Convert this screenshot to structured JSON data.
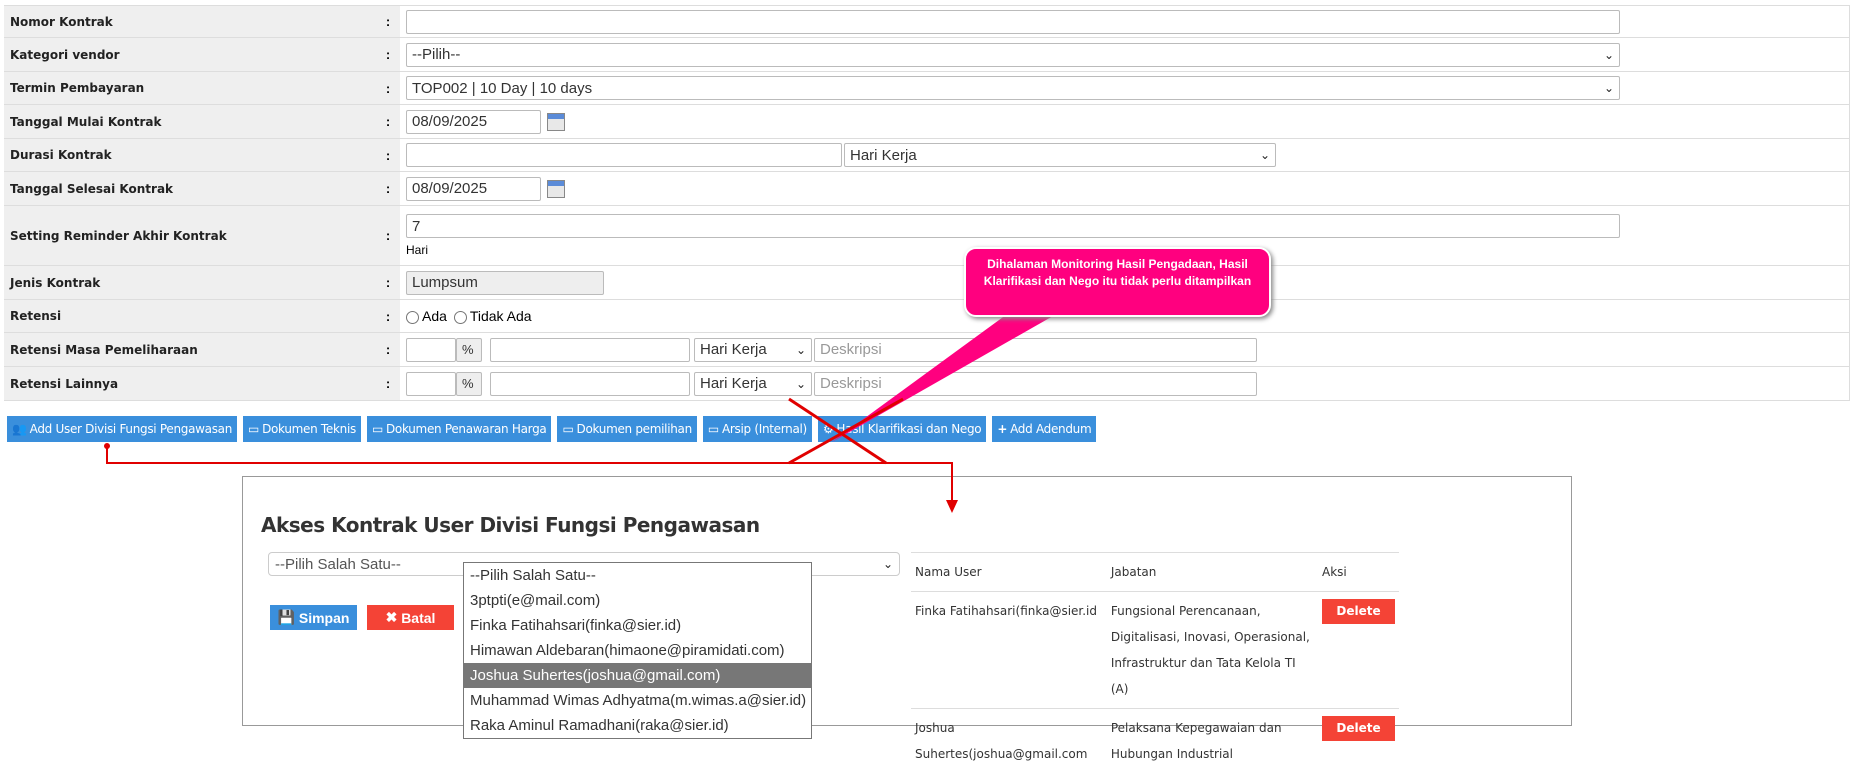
{
  "form": {
    "nomor_kontrak": {
      "label": "Nomor Kontrak",
      "value": ""
    },
    "kategori_vendor": {
      "label": "Kategori vendor",
      "value": "--Pilih--"
    },
    "termin": {
      "label": "Termin Pembayaran",
      "value": "TOP002 | 10 Day | 10 days"
    },
    "tgl_mulai": {
      "label": "Tanggal Mulai Kontrak",
      "value": "08/09/2025"
    },
    "durasi": {
      "label": "Durasi Kontrak",
      "value": "",
      "unit": "Hari Kerja"
    },
    "tgl_selesai": {
      "label": "Tanggal Selesai Kontrak",
      "value": "08/09/2025"
    },
    "reminder": {
      "label": "Setting Reminder Akhir Kontrak",
      "value": "7",
      "unit": "Hari"
    },
    "jenis": {
      "label": "Jenis Kontrak",
      "value": "Lumpsum"
    },
    "retensi": {
      "label": "Retensi",
      "opt1": "Ada",
      "opt2": "Tidak Ada"
    },
    "retensi_masa": {
      "label": "Retensi Masa Pemeliharaan",
      "pct": "%",
      "unit": "Hari Kerja",
      "desc_placeholder": "Deskripsi"
    },
    "retensi_lain": {
      "label": "Retensi Lainnya",
      "pct": "%",
      "unit": "Hari Kerja",
      "desc_placeholder": "Deskripsi"
    },
    "colon": ":"
  },
  "buttons": [
    "Add User Divisi Fungsi Pengawasan",
    "Dokumen Teknis",
    "Dokumen Penawaran Harga",
    "Dokumen pemilihan",
    "Arsip (Internal)",
    "Hasil Klarifikasi dan Nego",
    "Add Adendum"
  ],
  "callout": "Dihalaman Monitoring Hasil Pengadaan, Hasil Klarifikasi dan Nego itu tidak perlu ditampilkan",
  "modal": {
    "title": "Akses Kontrak User Divisi Fungsi Pengawasan",
    "select": "--Pilih Salah Satu--",
    "simpan": "Simpan",
    "batal": "Batal",
    "headers": [
      "Nama User",
      "Jabatan",
      "Aksi"
    ],
    "rows": [
      {
        "nama": "Finka Fatihahsari(finka@sier.id",
        "jabatan": "Fungsional Perencanaan, Digitalisasi, Inovasi, Operasional, Infrastruktur dan Tata Kelola TI (A)",
        "aksi": "Delete"
      },
      {
        "nama": "Joshua Suhertes(joshua@gmail.com",
        "jabatan": "Pelaksana Kepegawaian dan Hubungan Industrial",
        "aksi": "Delete"
      }
    ],
    "options": [
      "--Pilih Salah Satu--",
      "3ptpti(e@mail.com)",
      "Finka Fatihahsari(finka@sier.id)",
      "Himawan Aldebaran(himaone@piramidati.com)",
      "Joshua Suhertes(joshua@gmail.com)",
      "Muhammad Wimas Adhyatma(m.wimas.a@sier.id)",
      "Raka Aminul Ramadhani(raka@sier.id)"
    ],
    "highlighted_option": 4
  },
  "colors": {
    "button": "#3a8fdc",
    "danger": "#f44336",
    "callout": "#ff007f",
    "annotation": "#e00000"
  }
}
